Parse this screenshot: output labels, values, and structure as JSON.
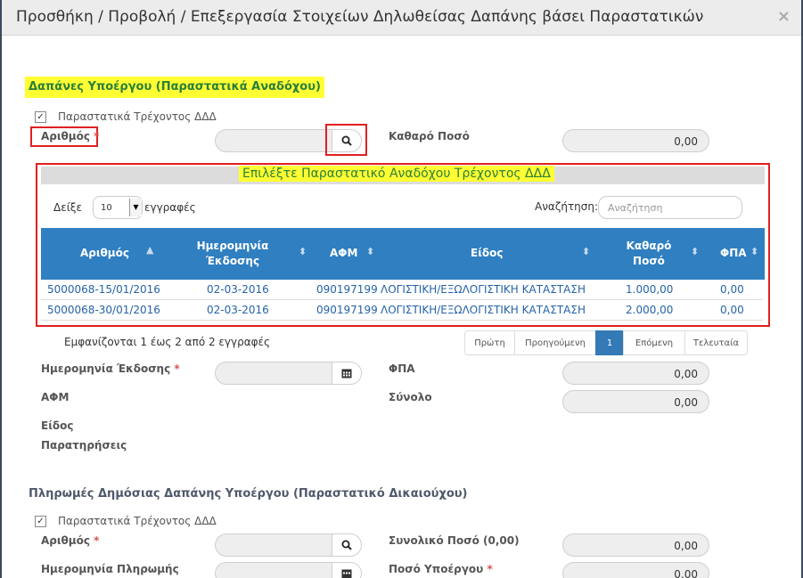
{
  "modal": {
    "title": "Προσθήκη / Προβολή / Επεξεργασία Στοιχείων Δηλωθείσας Δαπάνης βάσει Παραστατικών",
    "close": "×"
  },
  "section1": {
    "title": "Δαπάνες Υπoέργου (Παραστατικά Αναδόχου)",
    "checkbox_label": "Παραστατικά Τρέχοντος ΔΔΔ",
    "checkbox_mark": "✓",
    "number_label": "Αριθμός",
    "required": "*",
    "net_label": "Καθαρό Ποσό",
    "net_value": "0,00"
  },
  "picker": {
    "title": "Επιλέξτε Παραστατικό Αναδόχου Τρέχοντος ΔΔΔ",
    "show_label": "Δείξε",
    "show_value": "10",
    "records_label": "εγγραφές",
    "search_label": "Αναζήτηση:",
    "search_placeholder": "Αναζήτηση",
    "columns": [
      "Αριθμός",
      "Ημερομηνία Έκδοσης",
      "ΑΦΜ",
      "Είδος",
      "Καθαρό Ποσό",
      "ΦΠΑ"
    ],
    "rows": [
      {
        "number": "5000068-15/01/2016",
        "date": "02-03-2016",
        "afm": "090197199",
        "type": "ΛΟΓΙΣΤΙΚΗ/ΕΞΩΛΟΓΙΣΤΙΚΗ ΚΑΤΑΣΤΑΣΗ",
        "net": "1.000,00",
        "vat": "0,00"
      },
      {
        "number": "5000068-30/01/2016",
        "date": "02-03-2016",
        "afm": "090197199",
        "type": "ΛΟΓΙΣΤΙΚΗ/ΕΞΩΛΟΓΙΣΤΙΚΗ ΚΑΤΑΣΤΑΣΗ",
        "net": "2.000,00",
        "vat": "0,00"
      }
    ],
    "info": "Εμφανίζονται 1 έως 2 από 2 εγγραφές",
    "pager": {
      "first": "Πρώτη",
      "prev": "Προηγούμενη",
      "page": "1",
      "next": "Επόμενη",
      "last": "Τελευταία"
    }
  },
  "details": {
    "issue_date_label": "Ημερομηνία Έκδοσης",
    "vat_label": "ΦΠΑ",
    "vat_value": "0,00",
    "afm_label": "ΑΦΜ",
    "total_label": "Σύνολο",
    "total_value": "0,00",
    "type_label": "Είδος",
    "notes_label": "Παρατηρήσεις"
  },
  "section2": {
    "title": "Πληρωμές Δημόσιας Δαπάνης Υποέργου (Παραστατικό Δικαιούχου)",
    "checkbox_label": "Παραστατικά Τρέχοντος ΔΔΔ",
    "checkbox_mark": "✓",
    "number_label": "Αριθμός",
    "required": "*",
    "total_amount_label": "Συνολικό Ποσό (0,00)",
    "total_amount_value": "0,00",
    "payment_date_label": "Ημερομηνία Πληρωμής",
    "subproject_amount_label": "Ποσό Υποέργου",
    "subproject_amount_value": "0,00"
  }
}
